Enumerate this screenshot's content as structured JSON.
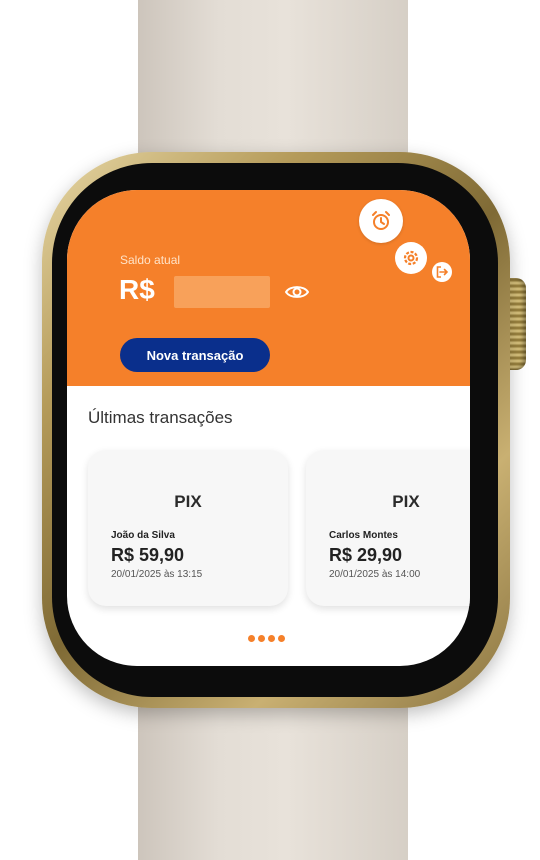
{
  "colors": {
    "header_bg": "#f5802a",
    "primary_button": "#0a2f8c",
    "page_dot": "#f5802a"
  },
  "header": {
    "balance_label": "Saldo atual",
    "currency": "R$",
    "balance_hidden": true,
    "toggle_icon": "eye-icon",
    "new_transaction_label": "Nova transação",
    "icons": [
      "alarm-icon",
      "gear-icon",
      "logout-icon"
    ]
  },
  "transactions": {
    "title": "Últimas transações",
    "items": [
      {
        "type": "PIX",
        "name": "João da Silva",
        "amount": "R$ 59,90",
        "date": "20/01/2025 às 13:15"
      },
      {
        "type": "PIX",
        "name": "Carlos Montes",
        "amount": "R$ 29,90",
        "date": "20/01/2025 às 14:00"
      }
    ]
  },
  "pagination": {
    "dots": 4
  }
}
